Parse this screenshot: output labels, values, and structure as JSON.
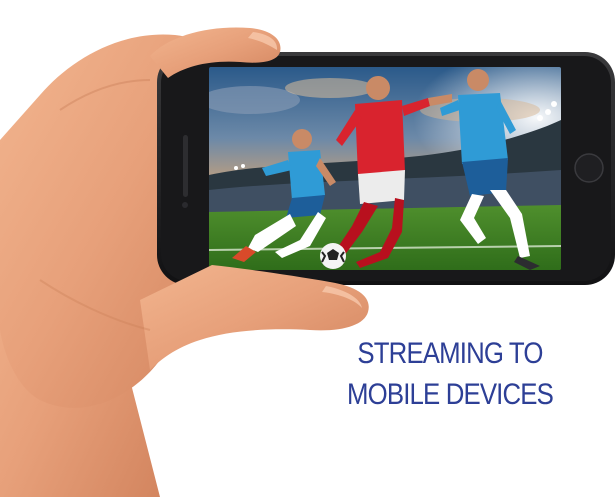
{
  "caption": {
    "line1": "STREAMING TO",
    "line2": "MOBILE DEVICES",
    "color": "#2d3f96"
  },
  "photo": {
    "description_icon": "hand-holding-phone-illustration",
    "screen_content_icon": "soccer-match-scene",
    "kit_colors": {
      "home": "#d9232e",
      "away": "#2f9bd6"
    }
  }
}
